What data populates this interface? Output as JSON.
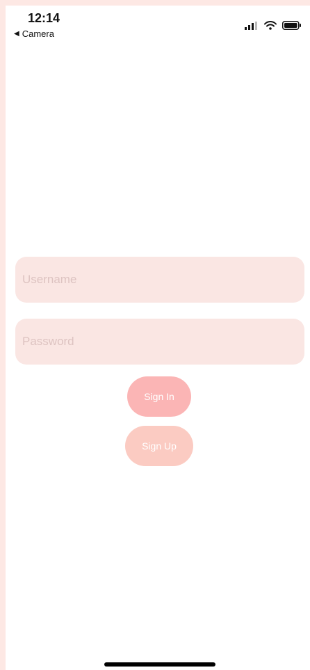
{
  "status_bar": {
    "time": "12:14",
    "back_label": "Camera",
    "back_icon": "back-triangle-icon",
    "icons": [
      "signal-icon",
      "wifi-icon",
      "battery-icon"
    ]
  },
  "login": {
    "username_placeholder": "Username",
    "password_placeholder": "Password",
    "sign_in_label": "Sign In",
    "sign_up_label": "Sign Up"
  },
  "colors": {
    "field_bg": "#fae6e3",
    "sign_in_bg": "#fbb5b5",
    "sign_up_bg": "#fbcbc2",
    "frame_bg": "#fde8e4"
  }
}
